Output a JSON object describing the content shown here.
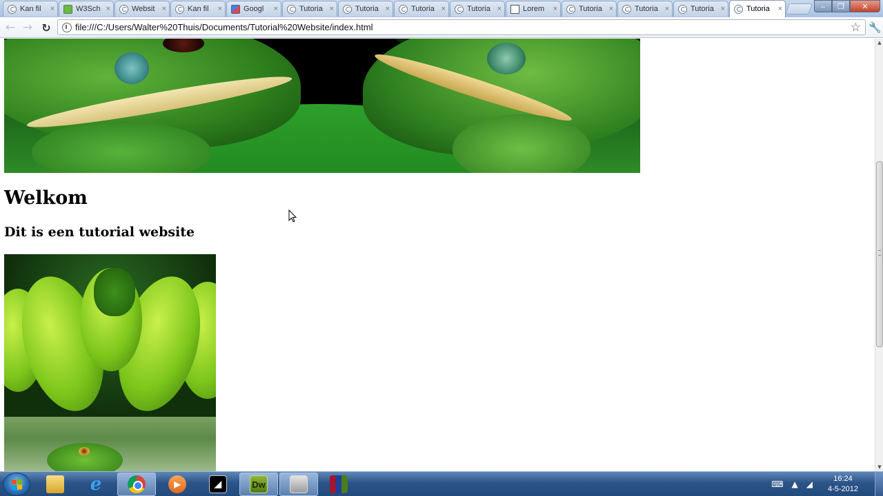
{
  "browser": {
    "tabs": [
      {
        "label": "Kan fil",
        "icon": "page-icon"
      },
      {
        "label": "W3Sch",
        "icon": "w3schools-icon"
      },
      {
        "label": "Websit",
        "icon": "page-icon"
      },
      {
        "label": "Kan fil",
        "icon": "page-icon"
      },
      {
        "label": "Googl",
        "icon": "google-icon"
      },
      {
        "label": "Tutoria",
        "icon": "page-icon"
      },
      {
        "label": "Tutoria",
        "icon": "page-icon"
      },
      {
        "label": "Tutoria",
        "icon": "page-icon"
      },
      {
        "label": "Tutoria",
        "icon": "page-icon"
      },
      {
        "label": "Lorem",
        "icon": "lorem-icon"
      },
      {
        "label": "Tutoria",
        "icon": "page-icon"
      },
      {
        "label": "Tutoria",
        "icon": "page-icon"
      },
      {
        "label": "Tutoria",
        "icon": "page-icon"
      },
      {
        "label": "Tutoria",
        "icon": "page-icon",
        "active": true
      }
    ],
    "tab_close_glyph": "×",
    "url": "file:///C:/Users/Walter%20Thuis/Documents/Tutorial%20Website/index.html",
    "window_buttons": {
      "minimize": "‒",
      "maximize": "❐",
      "close": "✕"
    }
  },
  "page": {
    "heading": "Welkom",
    "subheading": "Dit is een tutorial website",
    "images": [
      "frogs-banner",
      "green-tree-python",
      "green-lizard"
    ]
  },
  "taskbar": {
    "items": [
      "windows-explorer",
      "internet-explorer",
      "google-chrome",
      "media-player",
      "wireshark",
      "dreamweaver",
      "window",
      "winrar"
    ],
    "dreamweaver_label": "Dw",
    "clock": {
      "time": "16:24",
      "date": "4-5-2012"
    }
  },
  "colors": {
    "taskbar": "#2b5488",
    "tabstrip": "#a9c2e3",
    "page_background": "#ffffff"
  }
}
